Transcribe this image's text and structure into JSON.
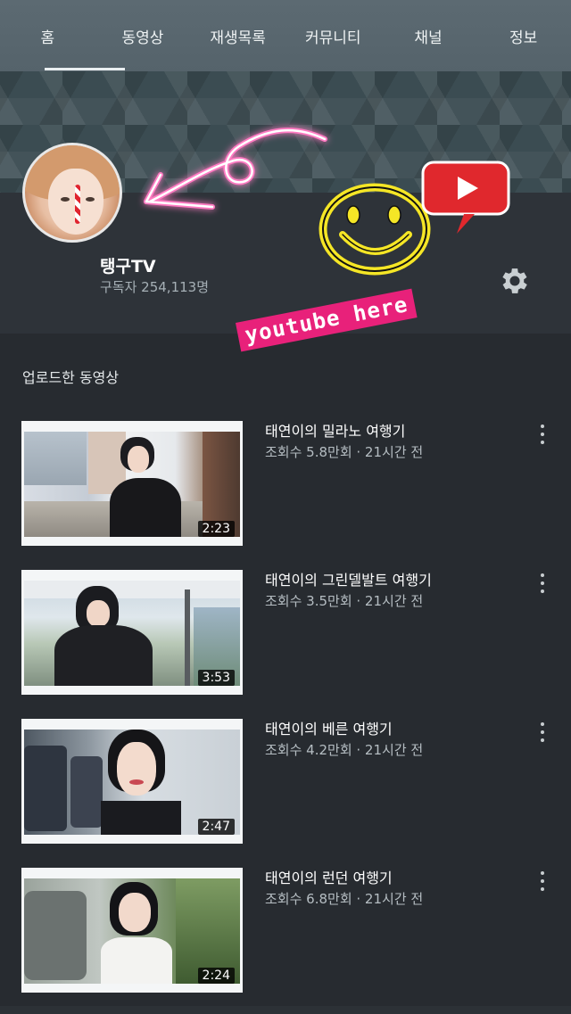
{
  "tabs": [
    {
      "label": "홈",
      "active": true
    },
    {
      "label": "동영상"
    },
    {
      "label": "재생목록"
    },
    {
      "label": "커뮤니티"
    },
    {
      "label": "채널"
    },
    {
      "label": "정보"
    }
  ],
  "channel": {
    "name": "탱구TV",
    "subscribers": "구독자 254,113명",
    "settings_icon": "gear-icon"
  },
  "stickers": {
    "caption": "youtube here",
    "smiley_color": "#f5e626",
    "youtube_color": "#e0282d",
    "arrow_color": "#ff3fa4"
  },
  "section": {
    "title": "업로드한 동영상"
  },
  "videos": [
    {
      "title": "태연이의 밀라노 여행기",
      "meta": "조회수 5.8만회 · 21시간 전",
      "duration": "2:23"
    },
    {
      "title": "태연이의 그린델발트 여행기",
      "meta": "조회수 3.5만회 · 21시간 전",
      "duration": "3:53"
    },
    {
      "title": "태연이의 베른 여행기",
      "meta": "조회수 4.2만회 · 21시간 전",
      "duration": "2:47"
    },
    {
      "title": "태연이의 런던 여행기",
      "meta": "조회수 6.8만회 · 21시간 전",
      "duration": "2:24"
    }
  ]
}
